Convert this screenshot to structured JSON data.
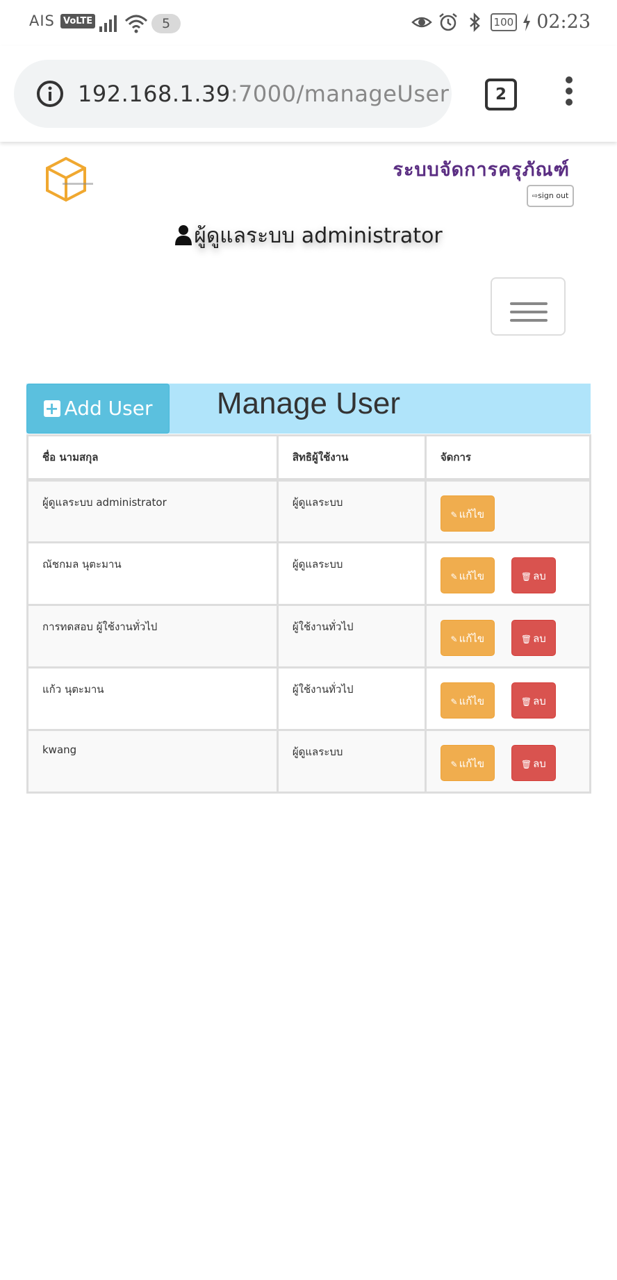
{
  "status_bar": {
    "carrier": "AIS",
    "volte": "VoLTE",
    "notification_count": "5",
    "battery": "100",
    "time": "02:23"
  },
  "browser": {
    "url_host": "192.168.1.39",
    "url_port": ":7000",
    "url_path": "/manageUser",
    "tab_count": "2"
  },
  "header": {
    "site_title": "ระบบจัดการครุภัณฑ์",
    "sign_out": "sign out",
    "current_user": "ผู้ดูแลระบบ administrator"
  },
  "panel": {
    "add_user_label": "Add User",
    "title": "Manage User"
  },
  "table": {
    "columns": [
      "ชื่อ นามสกุล",
      "สิทธิผู้ใช้งาน",
      "จัดการ"
    ],
    "edit_label": "แก้ไข",
    "delete_label": "ลบ",
    "rows": [
      {
        "name": "ผู้ดูแลระบบ administrator",
        "role": "ผู้ดูแลระบบ",
        "can_delete": false
      },
      {
        "name": "ณัชกมล นุตะมาน",
        "role": "ผู้ดูแลระบบ",
        "can_delete": true
      },
      {
        "name": "การทดสอบ ผู้ใช้งานทั่วไป",
        "role": "ผู้ใช้งานทั่วไป",
        "can_delete": true
      },
      {
        "name": "แก้ว นุตะมาน",
        "role": "ผู้ใช้งานทั่วไป",
        "can_delete": true
      },
      {
        "name": "kwang",
        "role": "ผู้ดูแลระบบ",
        "can_delete": true
      }
    ]
  },
  "colors": {
    "accent_info": "#5bc0de",
    "panel_header": "#b0e4fa",
    "edit": "#f0ad4e",
    "delete": "#d9534f",
    "title": "#5a2d82"
  }
}
